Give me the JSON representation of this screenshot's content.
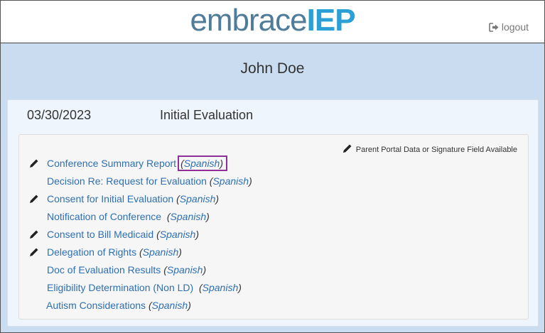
{
  "header": {
    "logo_part1": "embrace",
    "logo_part2": "IEP",
    "logout_label": "logout"
  },
  "student": {
    "name": "John Doe"
  },
  "meeting": {
    "date": "03/30/2023",
    "type": "Initial Evaluation",
    "legend": "Parent Portal Data or Signature Field Available",
    "documents": [
      {
        "title": "Conference Summary Report",
        "alt": "Spanish",
        "pencil": true,
        "highlighted": true
      },
      {
        "title": "Decision Re: Request for Evaluation",
        "alt": "Spanish",
        "pencil": false
      },
      {
        "title": "Consent for Initial Evaluation",
        "alt": "Spanish",
        "pencil": true
      },
      {
        "title": "Notification of Conference",
        "alt": "Spanish",
        "pencil": false
      },
      {
        "title": "Consent to Bill Medicaid",
        "alt": "Spanish",
        "pencil": true
      },
      {
        "title": "Delegation of Rights",
        "alt": "Spanish",
        "pencil": true
      },
      {
        "title": "Doc of Evaluation Results",
        "alt": "Spanish",
        "pencil": false
      },
      {
        "title": "Eligibility Determination (Non LD)",
        "alt": "Spanish",
        "pencil": false
      },
      {
        "title": "Autism Considerations",
        "alt": "Spanish",
        "pencil": false
      }
    ]
  },
  "colors": {
    "link": "#2e6fb3",
    "highlight_border": "#8e2f9a",
    "logo_gray_blue": "#4f7c98",
    "logo_bright_blue": "#2aa0d6"
  },
  "icons": {
    "edit": "pencil-icon",
    "logout": "logout-icon"
  }
}
